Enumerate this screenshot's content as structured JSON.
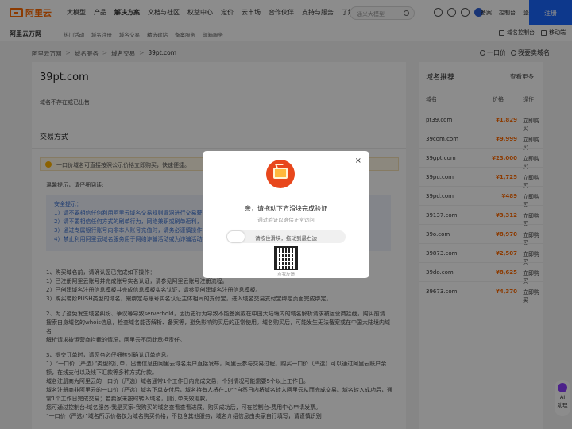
{
  "nav": {
    "logo_text": "阿里云",
    "links": [
      "大模型",
      "产品",
      "解决方案",
      "文档与社区",
      "权益中心",
      "定价",
      "云市场",
      "合作伙伴",
      "支持与服务",
      "了解阿里云"
    ],
    "search_placeholder": "通义大模型",
    "right_links": [
      "备案",
      "控制台",
      "登录"
    ],
    "register": "注册"
  },
  "subnav": {
    "title": "阿里云万网",
    "links": [
      "热门活动",
      "域名注册",
      "域名交易",
      "精选建站",
      "备案服务",
      "邮箱服务"
    ],
    "console": "域名控制台",
    "mobile": "移动端"
  },
  "breadcrumb": {
    "items": [
      "阿里云万网",
      "域名服务",
      "域名交易",
      "39pt.com"
    ],
    "sep": ">",
    "right": [
      "一口价",
      "我要卖域名"
    ]
  },
  "main": {
    "domain": "39pt.com",
    "note": "域名不存在或已出售",
    "section": "交易方式",
    "notice": "一口价域名可直接按照公示价格立即购买，快速便捷。",
    "tip_head": "温馨提示，请仔细阅读:",
    "safety": [
      "安全提示：",
      "1）请不要相信任何利用阿里云域名交易规则漏洞进行交易获益",
      "2）请不要相信任何方式的刷单行为，网络兼职或刷单返利，",
      "3）通过专属银行账号向非本人账号充值时，请务必谨慎操作",
      "4）禁止利用阿里云域名服务用于网络诈骗活动或为诈骗活动提供"
    ],
    "steps": [
      "1、购买域名前，请确认您已完成如下操作：",
      "1）已注册阿里云账号并完成账号实名认证，请参见阿里云账号注册流程。",
      "2）已创建域名注册信息模板并完成信息模板实名认证，请参见创建域名注册信息模板。",
      "3）购买带阶PUSH类型的域名，需绑定与账号实名认证主体相同的支付宝，进入域名交易支付宝绑定页面完成绑定。",
      "2、为了避免发生域名纠纷、争议等导致serverhold，因历史行为导致不能备案或在中国大陆境内的域名解析请求被运营商拦截，购买前请",
      "搜索自身域名的whois信息，检查域名能否解析、备案等，避免影响购买后的正常使用。域名购买后，可能发生无法备案或在中国大陆境内域名",
      "解析请求被运营商拦截的情况，阿里云不因此承担责任。",
      "3、提交订单时，请您务必仔细核对确认订单信息。",
      "1）“一口价（严选）”类型的订单，出售信息由阿里云域名用户直接发布，阿里云参与交易过程。购买一口价（严选）可以通过阿里云账户余",
      "额，在线支付以及线下汇款等多种方式付款。",
      "域名注册商为阿里云的一口价（严选）域名通常1个工作日内完成交易，个别情况可能需要5个以上工作日。",
      "域名注册商非阿里云的一口价（严选）域名下单支付后，域名持有人将在10个自然日内将域名转入阿里云从而完成交易。域名转入成功后，通",
      "常1个工作日完成交易；若卖家未按时转入域名，则订单失效退款。",
      "您可通过控制台-域名服务-我是买家-我购买的域名查看查看进展。购买成功后，可在控制台-费用中心申请发票。",
      "“一口价（严选）”域名所示价格仅为域名购买价格，不包含其他服务，域名介绍信息由卖家自行填写，请谨慎识别！"
    ]
  },
  "sidebar": {
    "title": "域名推荐",
    "more": "查看更多",
    "columns": [
      "域名",
      "价格",
      "操作"
    ],
    "rows": [
      {
        "domain": "pt39.com",
        "price": "¥1,829",
        "action": "立即购买"
      },
      {
        "domain": "39com.com",
        "price": "¥9,999",
        "action": "立即购买"
      },
      {
        "domain": "39gpt.com",
        "price": "¥23,000",
        "action": "立即购买"
      },
      {
        "domain": "39pu.com",
        "price": "¥1,725",
        "action": "立即购买"
      },
      {
        "domain": "39pd.com",
        "price": "¥489",
        "action": "立即购买"
      },
      {
        "domain": "39137.com",
        "price": "¥3,312",
        "action": "立即购买"
      },
      {
        "domain": "39o.com",
        "price": "¥8,970",
        "action": "立即购买"
      },
      {
        "domain": "39873.com",
        "price": "¥2,507",
        "action": "立即购买"
      },
      {
        "domain": "39do.com",
        "price": "¥8,625",
        "action": "立即购买"
      },
      {
        "domain": "39673.com",
        "price": "¥4,370",
        "action": "立即购买"
      }
    ]
  },
  "modal": {
    "title": "亲，请拖动下方滑块完成验证",
    "subtitle": "通过验证以确保正常访问",
    "slider_text": "请按住滑块，拖动到最右边",
    "qr_label": "点我反馈",
    "close": "×"
  },
  "ai_help": "AI\n助理",
  "colors": {
    "accent": "#ff6a00",
    "primary": "#1966ff",
    "link": "#3a6fcf"
  }
}
